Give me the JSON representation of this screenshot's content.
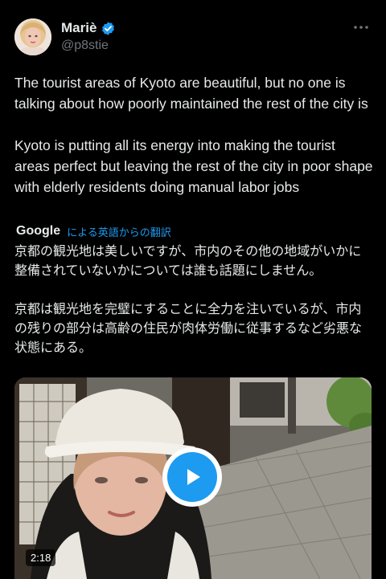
{
  "author": {
    "display_name": "Mariè",
    "handle": "@p8stie",
    "verified": true
  },
  "tweet": {
    "text": "The tourist areas of Kyoto are beautiful, but no one is talking about how poorly maintained the rest of the city is\n\nKyoto is putting all its energy into making the tourist areas perfect but leaving the rest of the city in poor shape with elderly residents doing manual labor jobs"
  },
  "translation": {
    "provider": "Google",
    "label": "による英語からの翻訳",
    "text": "京都の観光地は美しいですが、市内のその他の地域がいかに整備されていないかについては誰も話題にしません。\n\n京都は観光地を完璧にすることに全力を注いでいるが、市内の残りの部分は高齢の住民が肉体労働に従事するなど劣悪な状態にある。"
  },
  "media": {
    "duration": "2:18"
  },
  "icons": {
    "verified": "verified-badge-icon",
    "more": "more-horizontal-icon",
    "play": "play-icon"
  },
  "colors": {
    "background": "#000000",
    "text": "#e7e9ea",
    "secondary": "#71767b",
    "accent": "#1d9bf0"
  }
}
